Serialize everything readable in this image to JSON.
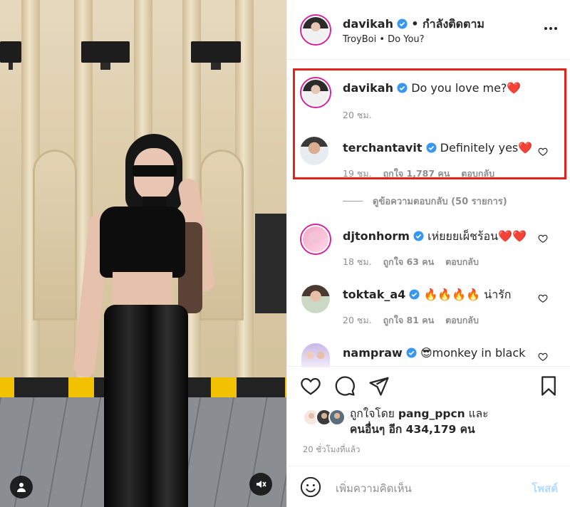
{
  "post": {
    "username": "davikah",
    "follow_status": "• กำลังติดตาม",
    "audio": "TroyBoi • Do You?",
    "more_icon": "more-horizontal-icon"
  },
  "thread": {
    "caption": {
      "username": "davikah",
      "text": "Do you love me?",
      "emoji": "❤️",
      "time": "20 ชม."
    },
    "reply": {
      "username": "terchantavit",
      "text": "Definitely yes",
      "emoji": "❤️",
      "time": "19 ชม.",
      "likes": "ถูกใจ 1,787 คน",
      "reply_label": "ตอบกลับ"
    },
    "view_replies": "ดูข้อความตอบกลับ (50 รายการ)"
  },
  "comments": [
    {
      "username": "djtonhorm",
      "text": "เห่ยยยเผ็ชร้อน",
      "emoji": "❤️❤️",
      "time": "18 ชม.",
      "likes": "ถูกใจ 63 คน",
      "reply_label": "ตอบกลับ"
    },
    {
      "username": "toktak_a4",
      "emoji_prefix": "🔥🔥🔥🔥",
      "text": "น่ารัก",
      "time": "20 ชม.",
      "likes": "ถูกใจ 81 คน",
      "reply_label": "ตอบกลับ"
    },
    {
      "username": "nampraw",
      "emoji_prefix": "😎",
      "text": "monkey in black"
    }
  ],
  "liked_by": {
    "prefix": "ถูกใจโดย",
    "user": "pang_ppcn",
    "and": "และ",
    "others": "คนอื่นๆ อีก 434,179 คน"
  },
  "time_ago": "20 ชั่วโมงที่แล้ว",
  "composer": {
    "placeholder": "เพิ่มความคิดเห็น",
    "post_label": "โพสต์"
  },
  "colors": {
    "highlight_border": "#e2231a",
    "verified_blue": "#3897f0",
    "heart_red": "#e0245e",
    "post_button_disabled": "#b3dbff"
  }
}
